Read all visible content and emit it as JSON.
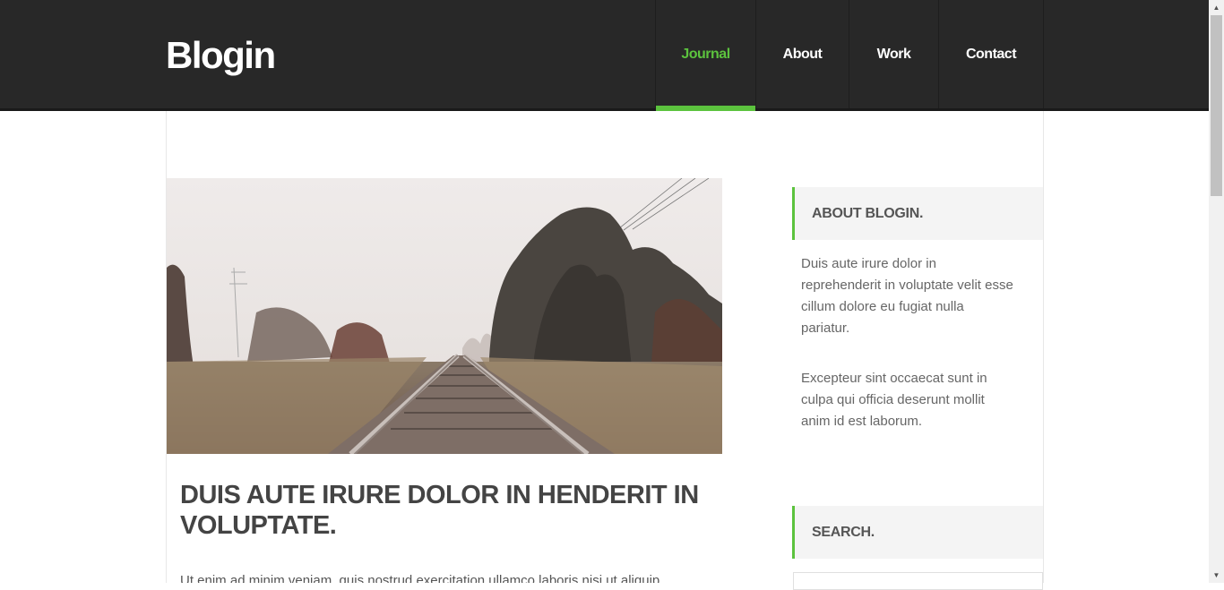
{
  "header": {
    "logo": "Blogin",
    "nav": [
      {
        "label": "Journal",
        "active": true
      },
      {
        "label": "About",
        "active": false
      },
      {
        "label": "Work",
        "active": false
      },
      {
        "label": "Contact",
        "active": false
      }
    ]
  },
  "post": {
    "image_alt": "Railway tracks through autumn trees",
    "title": "DUIS AUTE IRURE DOLOR IN HENDERIT IN VOLUPTATE.",
    "excerpt": "Ut enim ad minim veniam, quis nostrud exercitation ullamco laboris nisi ut aliquip"
  },
  "sidebar": {
    "about": {
      "heading": "ABOUT BLOGIN.",
      "paragraph1": "Duis aute irure dolor in reprehenderit in voluptate velit esse cillum dolore eu fugiat nulla pariatur.",
      "paragraph2": "Excepteur sint occaecat sunt in culpa qui officia deserunt mollit anim id est laborum."
    },
    "search": {
      "heading": "SEARCH.",
      "placeholder": ""
    }
  },
  "colors": {
    "accent": "#5cc33e",
    "header_bg": "#282828"
  }
}
